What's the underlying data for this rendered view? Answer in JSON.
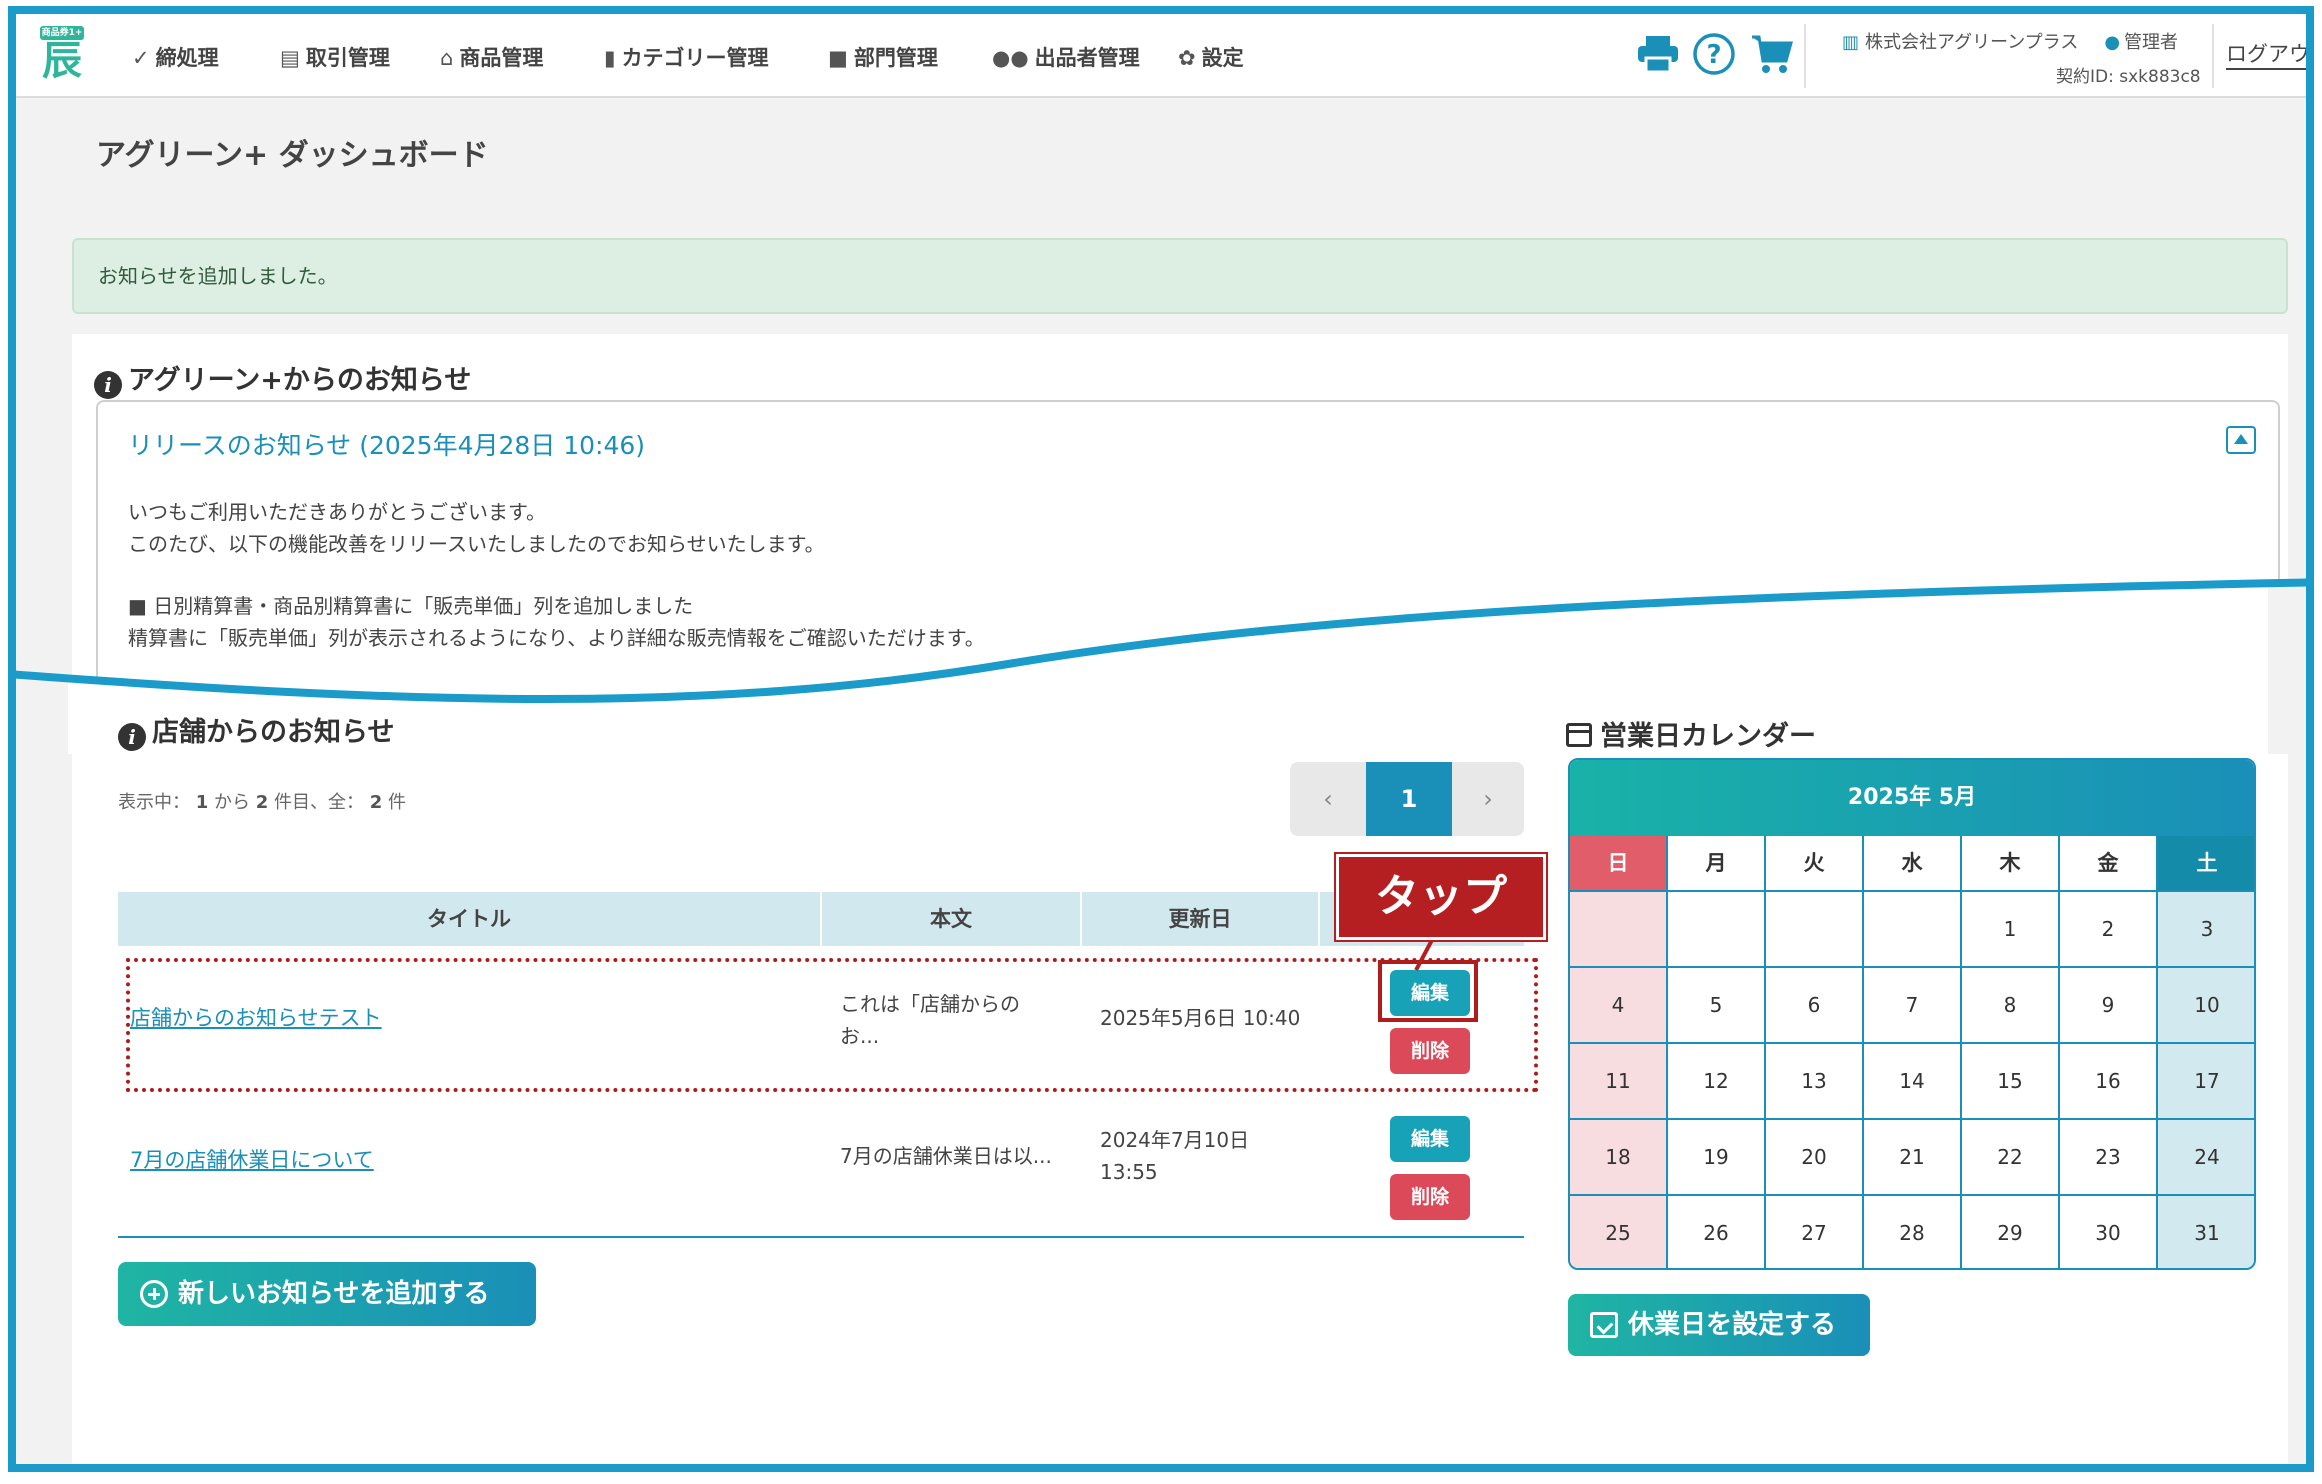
{
  "header": {
    "logo_text": "商品券1+",
    "nav": [
      {
        "label": "締処理",
        "icon": "check-circle-icon"
      },
      {
        "label": "取引管理",
        "icon": "list-icon"
      },
      {
        "label": "商品管理",
        "icon": "basket-icon"
      },
      {
        "label": "カテゴリー管理",
        "icon": "bookmark-icon"
      },
      {
        "label": "部門管理",
        "icon": "folder-icon"
      },
      {
        "label": "出品者管理",
        "icon": "users-icon"
      },
      {
        "label": "設定",
        "icon": "gear-icon"
      }
    ],
    "company": "株式会社アグリーンプラス",
    "role": "管理者",
    "contract_id": "契約ID: sxk883c8",
    "logout": "ログアウ"
  },
  "page_title": "アグリーン+ ダッシュボード",
  "alert": "お知らせを追加しました。",
  "agreen_notices": {
    "title": "アグリーン+からのお知らせ",
    "release_title": "リリースのお知らせ (2025年4月28日 10:46)",
    "lines": [
      "いつもご利用いただきありがとうございます。",
      "このたび、以下の機能改善をリリースいたしましたのでお知らせいたします。",
      "■ 日別精算書・商品別精算書に「販売単価」列を追加しました",
      "精算書に「販売単価」列が表示されるようになり、より詳細な販売情報をご確認いただけます。"
    ]
  },
  "store_notices": {
    "title": "店舗からのお知らせ",
    "showing_prefix": "表示中：",
    "showing_from": "1",
    "showing_mid": "から",
    "showing_to": "2",
    "showing_suffix": "件目、全：",
    "showing_total": "2",
    "showing_unit": "件",
    "pager": {
      "prev": "‹",
      "current": "1",
      "next": "›"
    },
    "columns": [
      "タイトル",
      "本文",
      "更新日",
      ""
    ],
    "rows": [
      {
        "title": "店舗からのお知らせテスト",
        "body_line1": "これは「店舗からの",
        "body_line2": "お...",
        "date_line1": "2025年5月6日 10:40",
        "date_line2": "",
        "edit": "編集",
        "delete": "削除"
      },
      {
        "title": "7月の店舗休業日について",
        "body_line1": "7月の店舗休業日は以...",
        "body_line2": "",
        "date_line1": "2024年7月10日",
        "date_line2": "13:55",
        "edit": "編集",
        "delete": "削除"
      }
    ],
    "add_button": "新しいお知らせを追加する",
    "callout": "タップ"
  },
  "calendar": {
    "title": "営業日カレンダー",
    "month": "2025年 5月",
    "weekdays": [
      "日",
      "月",
      "火",
      "水",
      "木",
      "金",
      "土"
    ],
    "weeks": [
      [
        "",
        "",
        "",
        "",
        "1",
        "2",
        "3"
      ],
      [
        "4",
        "5",
        "6",
        "7",
        "8",
        "9",
        "10"
      ],
      [
        "11",
        "12",
        "13",
        "14",
        "15",
        "16",
        "17"
      ],
      [
        "18",
        "19",
        "20",
        "21",
        "22",
        "23",
        "24"
      ],
      [
        "25",
        "26",
        "27",
        "28",
        "29",
        "30",
        "31"
      ]
    ],
    "holiday_button": "休業日を設定する"
  },
  "colors": {
    "accent": "#1a8fb8",
    "teal": "#17a2b8",
    "danger": "#dc4a5a",
    "sunday_header": "#e25d6a",
    "saturday_header": "#148ba8",
    "sunday_cell": "#f7dde0",
    "saturday_cell": "#d3e9f0",
    "highlight": "#b01c1c"
  }
}
